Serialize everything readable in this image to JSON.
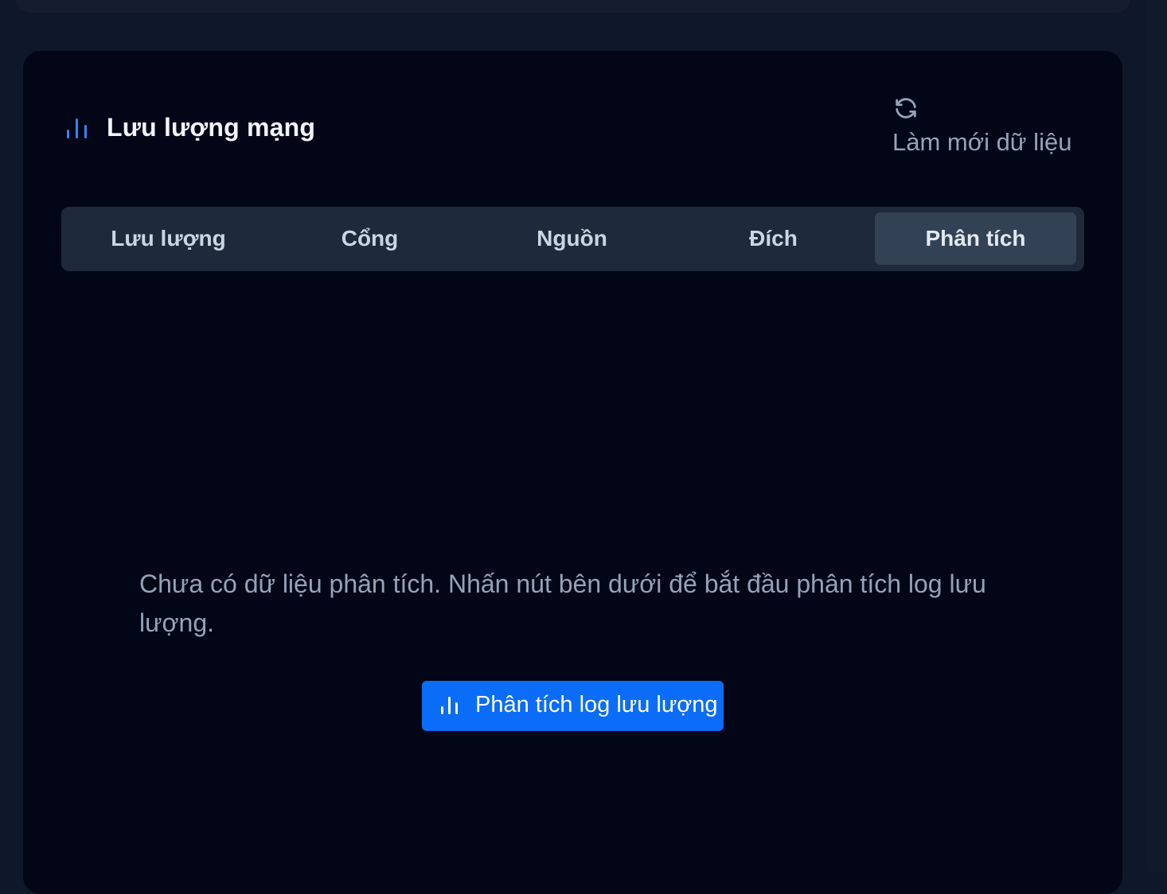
{
  "header": {
    "title": "Lưu lượng mạng",
    "title_icon": "bar-chart-icon",
    "refresh_icon": "refresh-icon",
    "refresh_label": "Làm mới dữ liệu"
  },
  "tabs": [
    {
      "label": "Lưu lượng",
      "active": false
    },
    {
      "label": "Cổng",
      "active": false
    },
    {
      "label": "Nguồn",
      "active": false
    },
    {
      "label": "Đích",
      "active": false
    },
    {
      "label": "Phân tích",
      "active": true
    }
  ],
  "analysis": {
    "empty_message": "Chưa có dữ liệu phân tích. Nhấn nút bên dưới để bắt đầu phân tích log lưu lượng.",
    "button_label": "Phân tích log lưu lượng",
    "button_icon": "bar-chart-icon"
  },
  "colors": {
    "accent": "#0b6cf8",
    "title_icon": "#3b82f6",
    "card_bg": "#020617",
    "page_bg": "#0f172a"
  }
}
